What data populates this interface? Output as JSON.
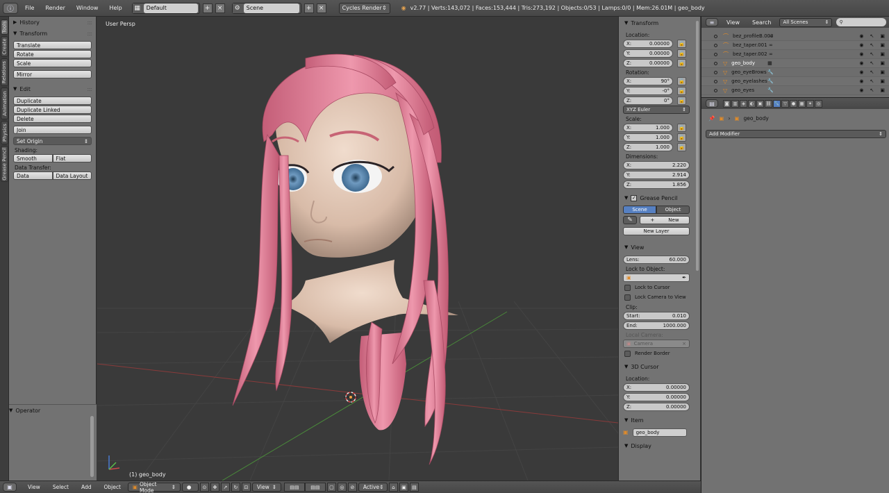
{
  "topbar": {
    "menus": [
      "File",
      "Render",
      "Window",
      "Help"
    ],
    "screen_layout": "Default",
    "scene": "Scene",
    "render_engine": "Cycles Render",
    "stats": "v2.77 | Verts:143,072 | Faces:153,444 | Tris:273,192 | Objects:0/53 | Lamps:0/0 | Mem:26.01M | geo_body"
  },
  "tool_tabs": [
    "Tools",
    "Create",
    "Relations",
    "Animation",
    "Physics",
    "Grease Pencil"
  ],
  "toolshelf": {
    "history": "History",
    "transform": {
      "title": "Transform",
      "buttons": [
        "Translate",
        "Rotate",
        "Scale",
        "Mirror"
      ]
    },
    "edit": {
      "title": "Edit",
      "buttons": [
        "Duplicate",
        "Duplicate Linked",
        "Delete",
        "Join"
      ],
      "set_origin": "Set Origin",
      "shading_label": "Shading:",
      "shading": [
        "Smooth",
        "Flat"
      ],
      "data_transfer_label": "Data Transfer:",
      "data_transfer": [
        "Data",
        "Data Layout"
      ]
    },
    "operator": "Operator"
  },
  "viewport": {
    "label": "User Persp",
    "object": "(1) geo_body"
  },
  "npanel": {
    "transform": "Transform",
    "location_label": "Location:",
    "location": [
      {
        "axis": "X:",
        "value": "0.00000"
      },
      {
        "axis": "Y:",
        "value": "0.00000"
      },
      {
        "axis": "Z:",
        "value": "0.00000"
      }
    ],
    "rotation_label": "Rotation:",
    "rotation": [
      {
        "axis": "X:",
        "value": "90°"
      },
      {
        "axis": "Y:",
        "value": "-0°"
      },
      {
        "axis": "Z:",
        "value": "0°"
      }
    ],
    "rotation_mode": "XYZ Euler",
    "scale_label": "Scale:",
    "scale": [
      {
        "axis": "X:",
        "value": "1.000"
      },
      {
        "axis": "Y:",
        "value": "1.000"
      },
      {
        "axis": "Z:",
        "value": "1.000"
      }
    ],
    "dimensions_label": "Dimensions:",
    "dimensions": [
      {
        "axis": "X:",
        "value": "2.220"
      },
      {
        "axis": "Y:",
        "value": "2.914"
      },
      {
        "axis": "Z:",
        "value": "1.856"
      }
    ],
    "grease_pencil": "Grease Pencil",
    "gp_scene": "Scene",
    "gp_object": "Object",
    "gp_new": "New",
    "gp_new_layer": "New Layer",
    "view": "View",
    "lens_label": "Lens:",
    "lens": "60.000",
    "lock_to_object": "Lock to Object:",
    "lock_to_cursor": "Lock to Cursor",
    "lock_camera": "Lock Camera to View",
    "clip_label": "Clip:",
    "clip_start_label": "Start:",
    "clip_start": "0.010",
    "clip_end_label": "End:",
    "clip_end": "1000.000",
    "local_camera": "Local Camera:",
    "camera": "Camera",
    "render_border": "Render Border",
    "cursor_3d": "3D Cursor",
    "cursor_location_label": "Location:",
    "cursor_location": [
      {
        "axis": "X:",
        "value": "0.00000"
      },
      {
        "axis": "Y:",
        "value": "0.00000"
      },
      {
        "axis": "Z:",
        "value": "0.00000"
      }
    ],
    "item": "Item",
    "item_name": "geo_body",
    "display": "Display"
  },
  "outliner": {
    "menus": [
      "View",
      "Search"
    ],
    "filter": "All Scenes",
    "rows": [
      {
        "name": "bez_profileB.003",
        "icon": "curve-icon"
      },
      {
        "name": "bez_taper.001",
        "icon": "curve-icon"
      },
      {
        "name": "bez_taper.002",
        "icon": "curve-icon"
      },
      {
        "name": "geo_body",
        "icon": "mesh-icon",
        "selected": true
      },
      {
        "name": "geo_eyeBrows",
        "icon": "mesh-icon"
      },
      {
        "name": "geo_eyelashes",
        "icon": "mesh-icon"
      },
      {
        "name": "geo_eyes",
        "icon": "mesh-icon"
      }
    ]
  },
  "properties": {
    "object": "geo_body",
    "add_modifier": "Add Modifier"
  },
  "bottombar": {
    "menus": [
      "View",
      "Select",
      "Add",
      "Object"
    ],
    "mode": "Object Mode",
    "view": "View",
    "active": "Active"
  },
  "colors": {
    "accent": "#5680c2",
    "hair": "#e58aa0",
    "skin": "#e9d3c4"
  }
}
